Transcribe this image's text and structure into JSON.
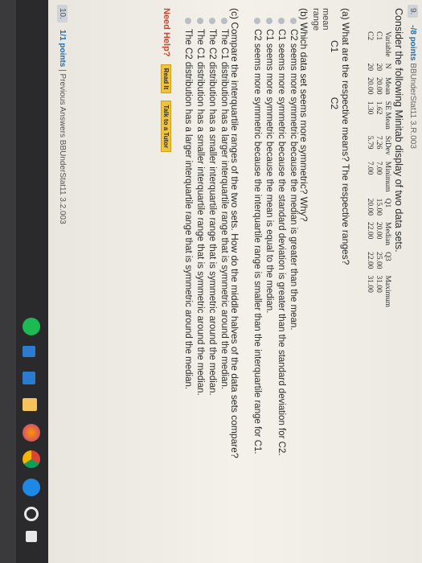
{
  "question9": {
    "number": "9.",
    "points": "-/8 points",
    "reference": "BBUnderStat11 3.R.003",
    "intro": "Consider the following Minitab display of two data sets.",
    "table": {
      "headers": [
        "Variable",
        "N",
        "Mean",
        "SE Mean",
        "StDev",
        "Minimum",
        "Q1",
        "Median",
        "Q3",
        "Maximum"
      ],
      "rows": [
        [
          "C1",
          "20",
          "20.00",
          "1.62",
          "7.26",
          "7.00",
          "15.00",
          "20.00",
          "25.00",
          "31.00"
        ],
        [
          "C2",
          "20",
          "20.00",
          "1.30",
          "5.79",
          "7.00",
          "20.00",
          "22.00",
          "22.00",
          "31.00"
        ]
      ]
    },
    "part_a": "(a) What are the respective means? The respective ranges?",
    "col_c1": "C1",
    "col_c2": "C2",
    "label_mean": "mean",
    "label_range": "range",
    "part_b": "(b) Which data set seems more symmetric? Why?",
    "part_b_options": [
      "C2 seems more symmetric because the median is greater than the mean.",
      "C1 seems more symmetric because the standard deviation is greater than the standard deviation for C2.",
      "C1 seems more symmetric because the mean is equal to the median.",
      "C2 seems more symmetric because the interquartile range is smaller than the interquartile range for C1."
    ],
    "part_c": "(c) Compare the interquartile ranges of the two sets. How do the middle halves of the data sets compare?",
    "part_c_options": [
      "The C1 distribution has a larger interquartile range that is symmetric around the median.",
      "The C2 distribution has a smaller interquartile range that is symmetric around the median.",
      "The C1 distribution has a smaller interquartile range that is symmetric around the median.",
      "The C2 distribution has a larger interquartile range that is symmetric around the median."
    ],
    "need_help": "Need Help?",
    "read_it": "Read It",
    "talk_tutor": "Talk to a Tutor"
  },
  "question10": {
    "number": "10.",
    "points": "1/1 points",
    "reference": "| Previous Answers BBUnderStat11 3.2.003"
  },
  "taskbar": {
    "icons": [
      "windows-start-icon",
      "cortana-search-icon",
      "edge-browser-icon",
      "chrome-icon",
      "firefox-icon",
      "file-explorer-icon",
      "store-icon",
      "mail-icon",
      "spotify-icon"
    ]
  },
  "colors": {
    "accent": "#1b6fb2",
    "help": "#c8462d",
    "button": "#f0c43a"
  }
}
